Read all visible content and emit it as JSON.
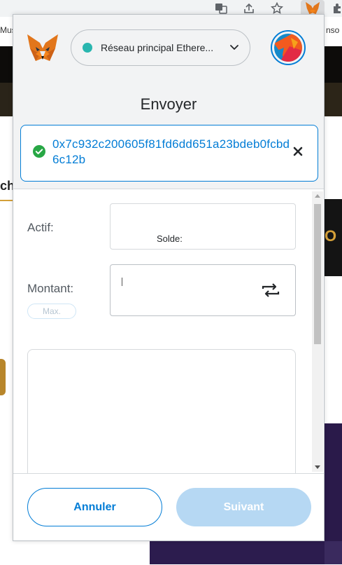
{
  "browser": {
    "bookmark_left": "Mus",
    "bookmark_right": "nso"
  },
  "background_page": {
    "fragment_ch": "ch",
    "fragment_o": "O"
  },
  "popup": {
    "network": {
      "label": "Réseau principal Ethere...",
      "status_color": "#29b6af"
    },
    "title": "Envoyer",
    "recipient": {
      "address": "0x7c932c200605f81fd6dd651a23bdeb0fcbd6c12b",
      "status_icon": "check-circle-icon",
      "status_color": "#28a745"
    },
    "asset": {
      "label": "Actif:",
      "balance_label": "Solde:"
    },
    "amount": {
      "label": "Montant:",
      "max_label": "Max."
    },
    "footer": {
      "cancel_label": "Annuler",
      "next_label": "Suivant"
    },
    "colors": {
      "accent": "#037dd6",
      "next_disabled": "#b6d8f3"
    }
  }
}
